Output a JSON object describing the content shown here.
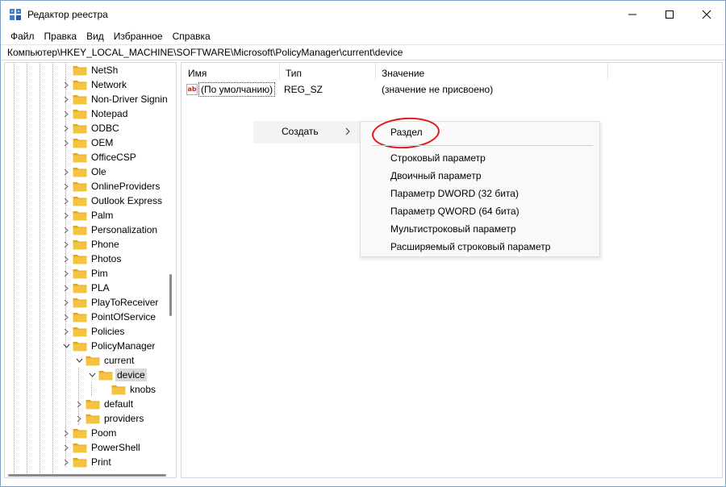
{
  "window": {
    "title": "Редактор реестра"
  },
  "menu": [
    "Файл",
    "Правка",
    "Вид",
    "Избранное",
    "Справка"
  ],
  "address": "Компьютер\\HKEY_LOCAL_MACHINE\\SOFTWARE\\Microsoft\\PolicyManager\\current\\device",
  "tree": {
    "items": [
      {
        "label": "NetSh",
        "expander": "none"
      },
      {
        "label": "Network",
        "expander": "closed"
      },
      {
        "label": "Non-Driver Signin",
        "expander": "closed"
      },
      {
        "label": "Notepad",
        "expander": "closed"
      },
      {
        "label": "ODBC",
        "expander": "closed"
      },
      {
        "label": "OEM",
        "expander": "closed"
      },
      {
        "label": "OfficeCSP",
        "expander": "none"
      },
      {
        "label": "Ole",
        "expander": "closed"
      },
      {
        "label": "OnlineProviders",
        "expander": "closed"
      },
      {
        "label": "Outlook Express",
        "expander": "closed"
      },
      {
        "label": "Palm",
        "expander": "closed"
      },
      {
        "label": "Personalization",
        "expander": "closed"
      },
      {
        "label": "Phone",
        "expander": "closed"
      },
      {
        "label": "Photos",
        "expander": "closed"
      },
      {
        "label": "Pim",
        "expander": "closed"
      },
      {
        "label": "PLA",
        "expander": "closed"
      },
      {
        "label": "PlayToReceiver",
        "expander": "closed"
      },
      {
        "label": "PointOfService",
        "expander": "closed"
      },
      {
        "label": "Policies",
        "expander": "closed"
      },
      {
        "label": "PolicyManager",
        "expander": "open"
      },
      {
        "label": "current",
        "expander": "open"
      },
      {
        "label": "device",
        "expander": "open",
        "selected": true
      },
      {
        "label": "knobs",
        "expander": "none"
      },
      {
        "label": "default",
        "expander": "closed"
      },
      {
        "label": "providers",
        "expander": "closed"
      },
      {
        "label": "Poom",
        "expander": "closed"
      },
      {
        "label": "PowerShell",
        "expander": "closed"
      },
      {
        "label": "Print",
        "expander": "closed"
      }
    ]
  },
  "list": {
    "columns": {
      "name": "Имя",
      "type": "Тип",
      "value": "Значение"
    },
    "rows": [
      {
        "name": "(По умолчанию)",
        "type": "REG_SZ",
        "value": "(значение не присвоено)",
        "icon": "string-value-icon"
      }
    ]
  },
  "context_menu": {
    "create_label": "Создать",
    "submenu": [
      "Раздел",
      "Строковый параметр",
      "Двоичный параметр",
      "Параметр DWORD (32 бита)",
      "Параметр QWORD (64 бита)",
      "Мультистроковый параметр",
      "Расширяемый строковый параметр"
    ]
  },
  "colors": {
    "folder": "#f5c342",
    "folder_dark": "#e0a82a",
    "highlight_ring": "#e0141b",
    "selected": "#d9d9d9"
  }
}
